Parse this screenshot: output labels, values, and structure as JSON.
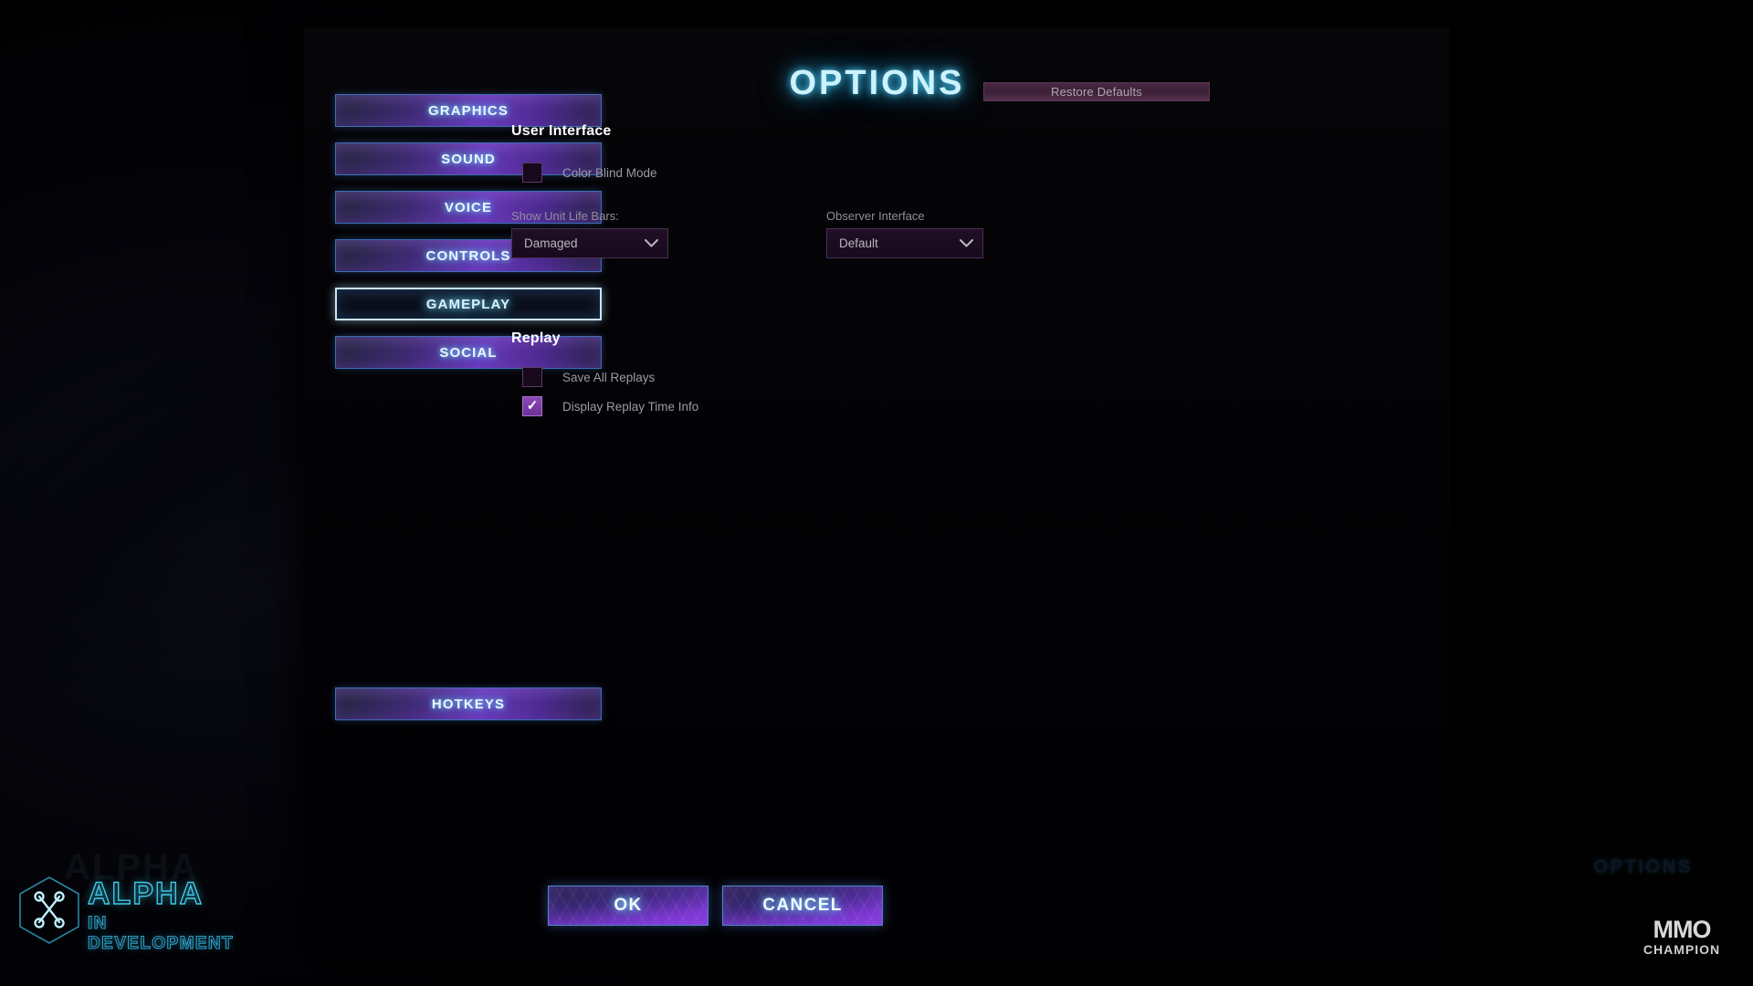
{
  "window": {
    "title": "OPTIONS"
  },
  "background": {
    "ghost_title": "OPTIONS"
  },
  "sidebar": {
    "tabs": [
      {
        "label": "GRAPHICS",
        "selected": false
      },
      {
        "label": "SOUND",
        "selected": false
      },
      {
        "label": "VOICE",
        "selected": false
      },
      {
        "label": "CONTROLS",
        "selected": false
      },
      {
        "label": "GAMEPLAY",
        "selected": true
      },
      {
        "label": "SOCIAL",
        "selected": false
      }
    ],
    "hotkeys_label": "HOTKEYS"
  },
  "toolbar": {
    "restore_defaults_label": "Restore Defaults"
  },
  "sections": {
    "user_interface": {
      "heading": "User Interface",
      "color_blind_mode": {
        "label": "Color Blind Mode",
        "checked": false
      },
      "show_unit_life_bars": {
        "label": "Show Unit Life Bars:",
        "value": "Damaged"
      },
      "observer_interface": {
        "label": "Observer Interface",
        "value": "Default"
      }
    },
    "replay": {
      "heading": "Replay",
      "save_all_replays": {
        "label": "Save All Replays",
        "checked": false
      },
      "display_replay_time_info": {
        "label": "Display Replay Time Info",
        "checked": true
      }
    }
  },
  "footer": {
    "ok_label": "OK",
    "cancel_label": "CANCEL"
  },
  "watermarks": {
    "alpha_line1": "ALPHA",
    "alpha_line2": "IN DEVELOPMENT",
    "alpha_ghost": "ALPHA",
    "mmo_line1": "MMO",
    "mmo_line2": "CHAMPION"
  },
  "colors": {
    "title_glow": "#49c8f0",
    "tab_accent": "#6a37b8",
    "tab_border": "#3b6fb5",
    "selected_border": "#c9e4f6",
    "checkbox_on": "#7b3fa0",
    "restore_bg": "#4a2844",
    "alpha_watermark": "#3fc8e8"
  }
}
